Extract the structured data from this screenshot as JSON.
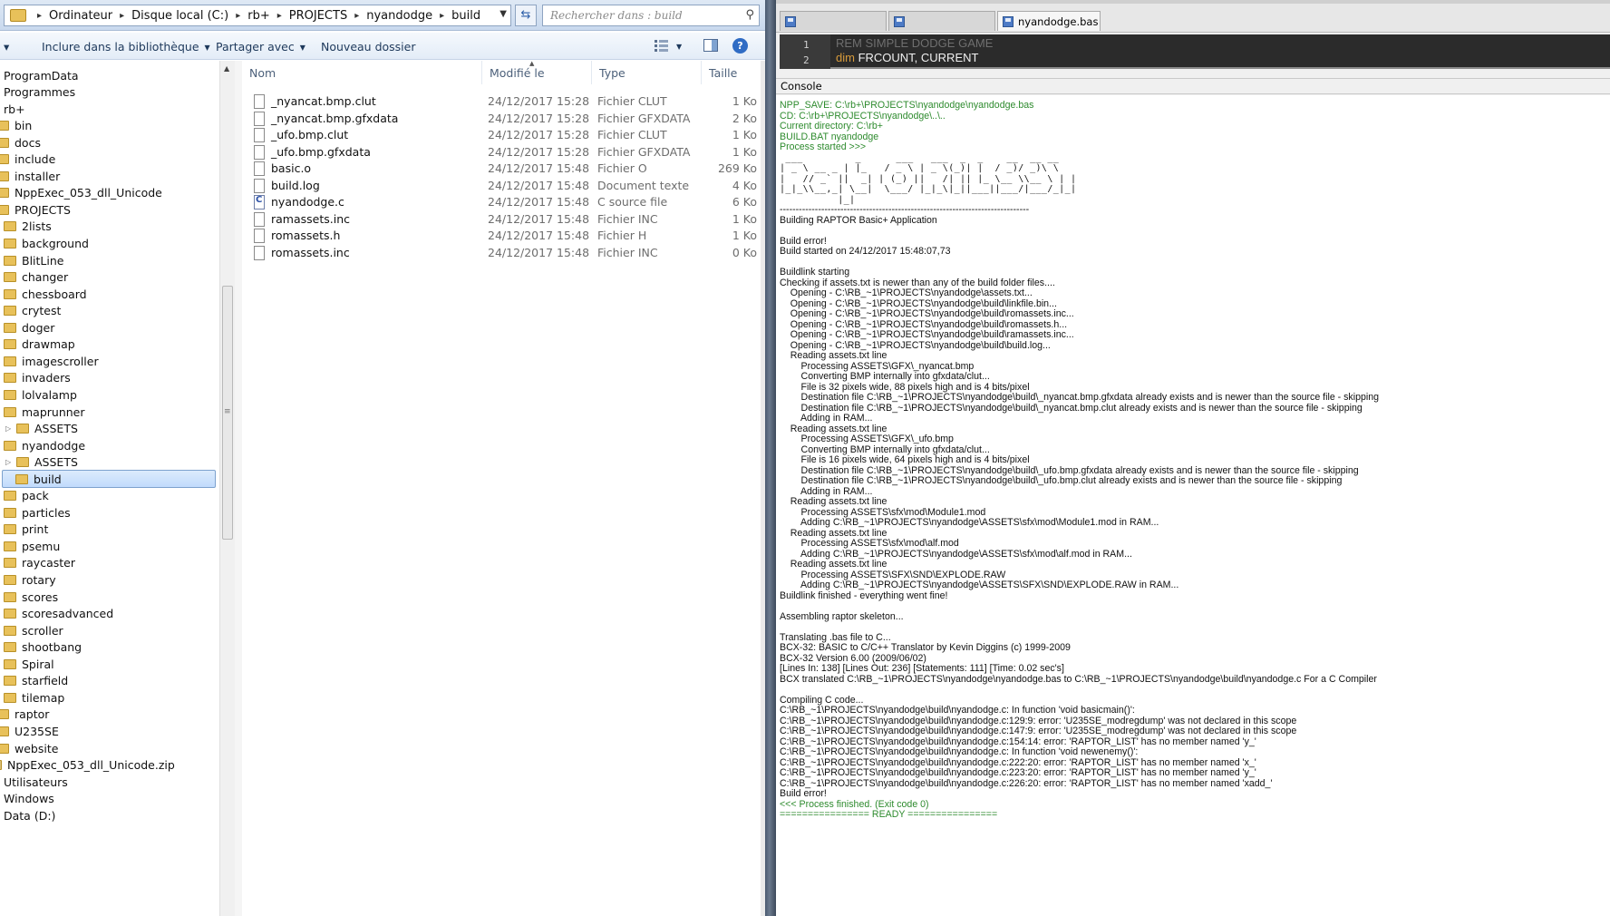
{
  "explorer": {
    "breadcrumb": [
      "Ordinateur",
      "Disque local (C:)",
      "rb+",
      "PROJECTS",
      "nyandodge",
      "build"
    ],
    "search_placeholder": "Rechercher dans : build",
    "toolbar": {
      "include_label": "Inclure dans la bibliothèque",
      "share_label": "Partager avec",
      "new_folder_label": "Nouveau dossier"
    },
    "nav_items": [
      {
        "label": "ProgramData",
        "folder": false,
        "indent": 0
      },
      {
        "label": "Programmes",
        "folder": false,
        "indent": 0
      },
      {
        "label": "rb+",
        "folder": false,
        "indent": 0
      },
      {
        "label": "bin",
        "folder": true,
        "indent": 0
      },
      {
        "label": "docs",
        "folder": true,
        "indent": 0
      },
      {
        "label": "include",
        "folder": true,
        "indent": 0
      },
      {
        "label": "installer",
        "folder": true,
        "indent": 0
      },
      {
        "label": "NppExec_053_dll_Unicode",
        "folder": true,
        "indent": 0
      },
      {
        "label": "PROJECTS",
        "folder": true,
        "indent": 0
      },
      {
        "label": "2lists",
        "folder": true,
        "indent": 1
      },
      {
        "label": "background",
        "folder": true,
        "indent": 1
      },
      {
        "label": "BlitLine",
        "folder": true,
        "indent": 1
      },
      {
        "label": "changer",
        "folder": true,
        "indent": 1
      },
      {
        "label": "chessboard",
        "folder": true,
        "indent": 1
      },
      {
        "label": "crytest",
        "folder": true,
        "indent": 1
      },
      {
        "label": "doger",
        "folder": true,
        "indent": 1
      },
      {
        "label": "drawmap",
        "folder": true,
        "indent": 1
      },
      {
        "label": "imagescroller",
        "folder": true,
        "indent": 1
      },
      {
        "label": "invaders",
        "folder": true,
        "indent": 1
      },
      {
        "label": "lolvalamp",
        "folder": true,
        "indent": 1
      },
      {
        "label": "maprunner",
        "folder": true,
        "indent": 1
      },
      {
        "label": "ASSETS",
        "folder": true,
        "indent": 2,
        "expander": true
      },
      {
        "label": "nyandodge",
        "folder": true,
        "indent": 1
      },
      {
        "label": "ASSETS",
        "folder": true,
        "indent": 2,
        "expander": true
      },
      {
        "label": "build",
        "folder": true,
        "indent": 2,
        "selected": true
      },
      {
        "label": "pack",
        "folder": true,
        "indent": 1
      },
      {
        "label": "particles",
        "folder": true,
        "indent": 1
      },
      {
        "label": "print",
        "folder": true,
        "indent": 1
      },
      {
        "label": "psemu",
        "folder": true,
        "indent": 1
      },
      {
        "label": "raycaster",
        "folder": true,
        "indent": 1
      },
      {
        "label": "rotary",
        "folder": true,
        "indent": 1
      },
      {
        "label": "scores",
        "folder": true,
        "indent": 1
      },
      {
        "label": "scoresadvanced",
        "folder": true,
        "indent": 1
      },
      {
        "label": "scroller",
        "folder": true,
        "indent": 1
      },
      {
        "label": "shootbang",
        "folder": true,
        "indent": 1
      },
      {
        "label": "Spiral",
        "folder": true,
        "indent": 1
      },
      {
        "label": "starfield",
        "folder": true,
        "indent": 1
      },
      {
        "label": "tilemap",
        "folder": true,
        "indent": 1
      },
      {
        "label": "raptor",
        "folder": true,
        "indent": 0
      },
      {
        "label": "U235SE",
        "folder": true,
        "indent": 0
      },
      {
        "label": "website",
        "folder": true,
        "indent": 0
      },
      {
        "label": "NppExec_053_dll_Unicode.zip",
        "folder": false,
        "indent": 0,
        "zip": true
      },
      {
        "label": "Utilisateurs",
        "folder": false,
        "indent": 0
      },
      {
        "label": "Windows",
        "folder": false,
        "indent": 0
      },
      {
        "label": "Data (D:)",
        "folder": false,
        "indent": 0
      }
    ],
    "columns": [
      "Nom",
      "Modifié le",
      "Type",
      "Taille"
    ],
    "files": [
      {
        "name": "_nyancat.bmp.clut",
        "date": "24/12/2017 15:28",
        "type": "Fichier CLUT",
        "size": "1 Ko",
        "icon": "doc"
      },
      {
        "name": "_nyancat.bmp.gfxdata",
        "date": "24/12/2017 15:28",
        "type": "Fichier GFXDATA",
        "size": "2 Ko",
        "icon": "doc"
      },
      {
        "name": "_ufo.bmp.clut",
        "date": "24/12/2017 15:28",
        "type": "Fichier CLUT",
        "size": "1 Ko",
        "icon": "doc"
      },
      {
        "name": "_ufo.bmp.gfxdata",
        "date": "24/12/2017 15:28",
        "type": "Fichier GFXDATA",
        "size": "1 Ko",
        "icon": "doc"
      },
      {
        "name": "basic.o",
        "date": "24/12/2017 15:48",
        "type": "Fichier O",
        "size": "269 Ko",
        "icon": "doc"
      },
      {
        "name": "build.log",
        "date": "24/12/2017 15:48",
        "type": "Document texte",
        "size": "4 Ko",
        "icon": "doc"
      },
      {
        "name": "nyandodge.c",
        "date": "24/12/2017 15:48",
        "type": "C source file",
        "size": "6 Ko",
        "icon": "csrc"
      },
      {
        "name": "ramassets.inc",
        "date": "24/12/2017 15:48",
        "type": "Fichier INC",
        "size": "1 Ko",
        "icon": "doc"
      },
      {
        "name": "romassets.h",
        "date": "24/12/2017 15:48",
        "type": "Fichier H",
        "size": "1 Ko",
        "icon": "doc"
      },
      {
        "name": "romassets.inc",
        "date": "24/12/2017 15:48",
        "type": "Fichier INC",
        "size": "0 Ko",
        "icon": "doc"
      }
    ]
  },
  "npp": {
    "tabs": [
      {
        "label": "",
        "active": false
      },
      {
        "label": "",
        "active": false
      },
      {
        "label": "nyandodge.bas",
        "active": true
      }
    ],
    "editor_lines": [
      {
        "num": "1",
        "kw": "",
        "rem": "REM SIMPLE DODGE GAME",
        "rest": ""
      },
      {
        "num": "2",
        "kw": "dim",
        "rem": "",
        "rest": " FRCOUNT, CURRENT"
      }
    ],
    "console_title": "Console",
    "console_lines": [
      {
        "t": "NPP_SAVE: C:\\rb+\\PROJECTS\\nyandodge\\nyandodge.bas",
        "c": "green"
      },
      {
        "t": "CD: C:\\rb+\\PROJECTS\\nyandodge\\..\\..",
        "c": "green"
      },
      {
        "t": "Current directory: C:\\rb+",
        "c": "green"
      },
      {
        "t": "BUILD.BAT nyandodge",
        "c": "green"
      },
      {
        "t": "Process started >>>",
        "c": "green"
      },
      {
        "t": " ___         _      ___   ___  _  _    __  __ __  ",
        "c": "ascii"
      },
      {
        "t": "| _ \\ __ _ | |_   / _ \\ | _ \\(_)| |  / _)/ _)\\ \\ ",
        "c": "ascii"
      },
      {
        "t": "|   // _` ||  _| | (_) ||   /| || |_ \\__ \\\\__ \\ | |",
        "c": "ascii"
      },
      {
        "t": "|_|_\\\\__,_| \\__|  \\___/ |_|_\\|_||___||___/|___/_|_|",
        "c": "ascii"
      },
      {
        "t": "          |_|",
        "c": "ascii"
      },
      {
        "t": "------------------------------------------------------------------------------",
        "c": ""
      },
      {
        "t": "Building RAPTOR Basic+ Application",
        "c": ""
      },
      {
        "t": "",
        "c": ""
      },
      {
        "t": "Build error!",
        "c": ""
      },
      {
        "t": "Build started on 24/12/2017 15:48:07,73",
        "c": ""
      },
      {
        "t": "",
        "c": ""
      },
      {
        "t": "Buildlink starting",
        "c": ""
      },
      {
        "t": "Checking if assets.txt is newer than any of the build folder files....",
        "c": ""
      },
      {
        "t": "    Opening - C:\\RB_~1\\PROJECTS\\nyandodge\\assets.txt...",
        "c": ""
      },
      {
        "t": "    Opening - C:\\RB_~1\\PROJECTS\\nyandodge\\build\\linkfile.bin...",
        "c": ""
      },
      {
        "t": "    Opening - C:\\RB_~1\\PROJECTS\\nyandodge\\build\\romassets.inc...",
        "c": ""
      },
      {
        "t": "    Opening - C:\\RB_~1\\PROJECTS\\nyandodge\\build\\romassets.h...",
        "c": ""
      },
      {
        "t": "    Opening - C:\\RB_~1\\PROJECTS\\nyandodge\\build\\ramassets.inc...",
        "c": ""
      },
      {
        "t": "    Opening - C:\\RB_~1\\PROJECTS\\nyandodge\\build\\build.log...",
        "c": ""
      },
      {
        "t": "    Reading assets.txt line",
        "c": ""
      },
      {
        "t": "        Processing ASSETS\\GFX\\_nyancat.bmp",
        "c": ""
      },
      {
        "t": "        Converting BMP internally into gfxdata/clut...",
        "c": ""
      },
      {
        "t": "        File is 32 pixels wide, 88 pixels high and is 4 bits/pixel",
        "c": ""
      },
      {
        "t": "        Destination file C:\\RB_~1\\PROJECTS\\nyandodge\\build\\_nyancat.bmp.gfxdata already exists and is newer than the source file - skipping",
        "c": ""
      },
      {
        "t": "        Destination file C:\\RB_~1\\PROJECTS\\nyandodge\\build\\_nyancat.bmp.clut already exists and is newer than the source file - skipping",
        "c": ""
      },
      {
        "t": "        Adding in RAM...",
        "c": ""
      },
      {
        "t": "    Reading assets.txt line",
        "c": ""
      },
      {
        "t": "        Processing ASSETS\\GFX\\_ufo.bmp",
        "c": ""
      },
      {
        "t": "        Converting BMP internally into gfxdata/clut...",
        "c": ""
      },
      {
        "t": "        File is 16 pixels wide, 64 pixels high and is 4 bits/pixel",
        "c": ""
      },
      {
        "t": "        Destination file C:\\RB_~1\\PROJECTS\\nyandodge\\build\\_ufo.bmp.gfxdata already exists and is newer than the source file - skipping",
        "c": ""
      },
      {
        "t": "        Destination file C:\\RB_~1\\PROJECTS\\nyandodge\\build\\_ufo.bmp.clut already exists and is newer than the source file - skipping",
        "c": ""
      },
      {
        "t": "        Adding in RAM...",
        "c": ""
      },
      {
        "t": "    Reading assets.txt line",
        "c": ""
      },
      {
        "t": "        Processing ASSETS\\sfx\\mod\\Module1.mod",
        "c": ""
      },
      {
        "t": "        Adding C:\\RB_~1\\PROJECTS\\nyandodge\\ASSETS\\sfx\\mod\\Module1.mod in RAM...",
        "c": ""
      },
      {
        "t": "    Reading assets.txt line",
        "c": ""
      },
      {
        "t": "        Processing ASSETS\\sfx\\mod\\alf.mod",
        "c": ""
      },
      {
        "t": "        Adding C:\\RB_~1\\PROJECTS\\nyandodge\\ASSETS\\sfx\\mod\\alf.mod in RAM...",
        "c": ""
      },
      {
        "t": "    Reading assets.txt line",
        "c": ""
      },
      {
        "t": "        Processing ASSETS\\SFX\\SND\\EXPLODE.RAW",
        "c": ""
      },
      {
        "t": "        Adding C:\\RB_~1\\PROJECTS\\nyandodge\\ASSETS\\SFX\\SND\\EXPLODE.RAW in RAM...",
        "c": ""
      },
      {
        "t": "Buildlink finished - everything went fine!",
        "c": ""
      },
      {
        "t": "",
        "c": ""
      },
      {
        "t": "Assembling raptor skeleton...",
        "c": ""
      },
      {
        "t": "",
        "c": ""
      },
      {
        "t": "Translating .bas file to C...",
        "c": ""
      },
      {
        "t": "BCX-32: BASIC to C/C++ Translator by Kevin Diggins (c) 1999-2009",
        "c": ""
      },
      {
        "t": "BCX-32 Version 6.00 (2009/06/02)",
        "c": ""
      },
      {
        "t": "[Lines In: 138] [Lines Out: 236] [Statements: 111] [Time: 0.02 sec's]",
        "c": ""
      },
      {
        "t": "BCX translated C:\\RB_~1\\PROJECTS\\nyandodge\\nyandodge.bas to C:\\RB_~1\\PROJECTS\\nyandodge\\build\\nyandodge.c For a C Compiler",
        "c": ""
      },
      {
        "t": "",
        "c": ""
      },
      {
        "t": "Compiling C code...",
        "c": ""
      },
      {
        "t": "C:\\RB_~1\\PROJECTS\\nyandodge\\build\\nyandodge.c: In function 'void basicmain()':",
        "c": ""
      },
      {
        "t": "C:\\RB_~1\\PROJECTS\\nyandodge\\build\\nyandodge.c:129:9: error: 'U235SE_modregdump' was not declared in this scope",
        "c": ""
      },
      {
        "t": "C:\\RB_~1\\PROJECTS\\nyandodge\\build\\nyandodge.c:147:9: error: 'U235SE_modregdump' was not declared in this scope",
        "c": ""
      },
      {
        "t": "C:\\RB_~1\\PROJECTS\\nyandodge\\build\\nyandodge.c:154:14: error: 'RAPTOR_LIST' has no member named 'y_'",
        "c": ""
      },
      {
        "t": "C:\\RB_~1\\PROJECTS\\nyandodge\\build\\nyandodge.c: In function 'void newenemy()':",
        "c": ""
      },
      {
        "t": "C:\\RB_~1\\PROJECTS\\nyandodge\\build\\nyandodge.c:222:20: error: 'RAPTOR_LIST' has no member named 'x_'",
        "c": ""
      },
      {
        "t": "C:\\RB_~1\\PROJECTS\\nyandodge\\build\\nyandodge.c:223:20: error: 'RAPTOR_LIST' has no member named 'y_'",
        "c": ""
      },
      {
        "t": "C:\\RB_~1\\PROJECTS\\nyandodge\\build\\nyandodge.c:226:20: error: 'RAPTOR_LIST' has no member named 'xadd_'",
        "c": ""
      },
      {
        "t": "Build error!",
        "c": ""
      },
      {
        "t": "<<< Process finished. (Exit code 0)",
        "c": "green"
      },
      {
        "t": "================ READY ================",
        "c": "green"
      }
    ]
  }
}
